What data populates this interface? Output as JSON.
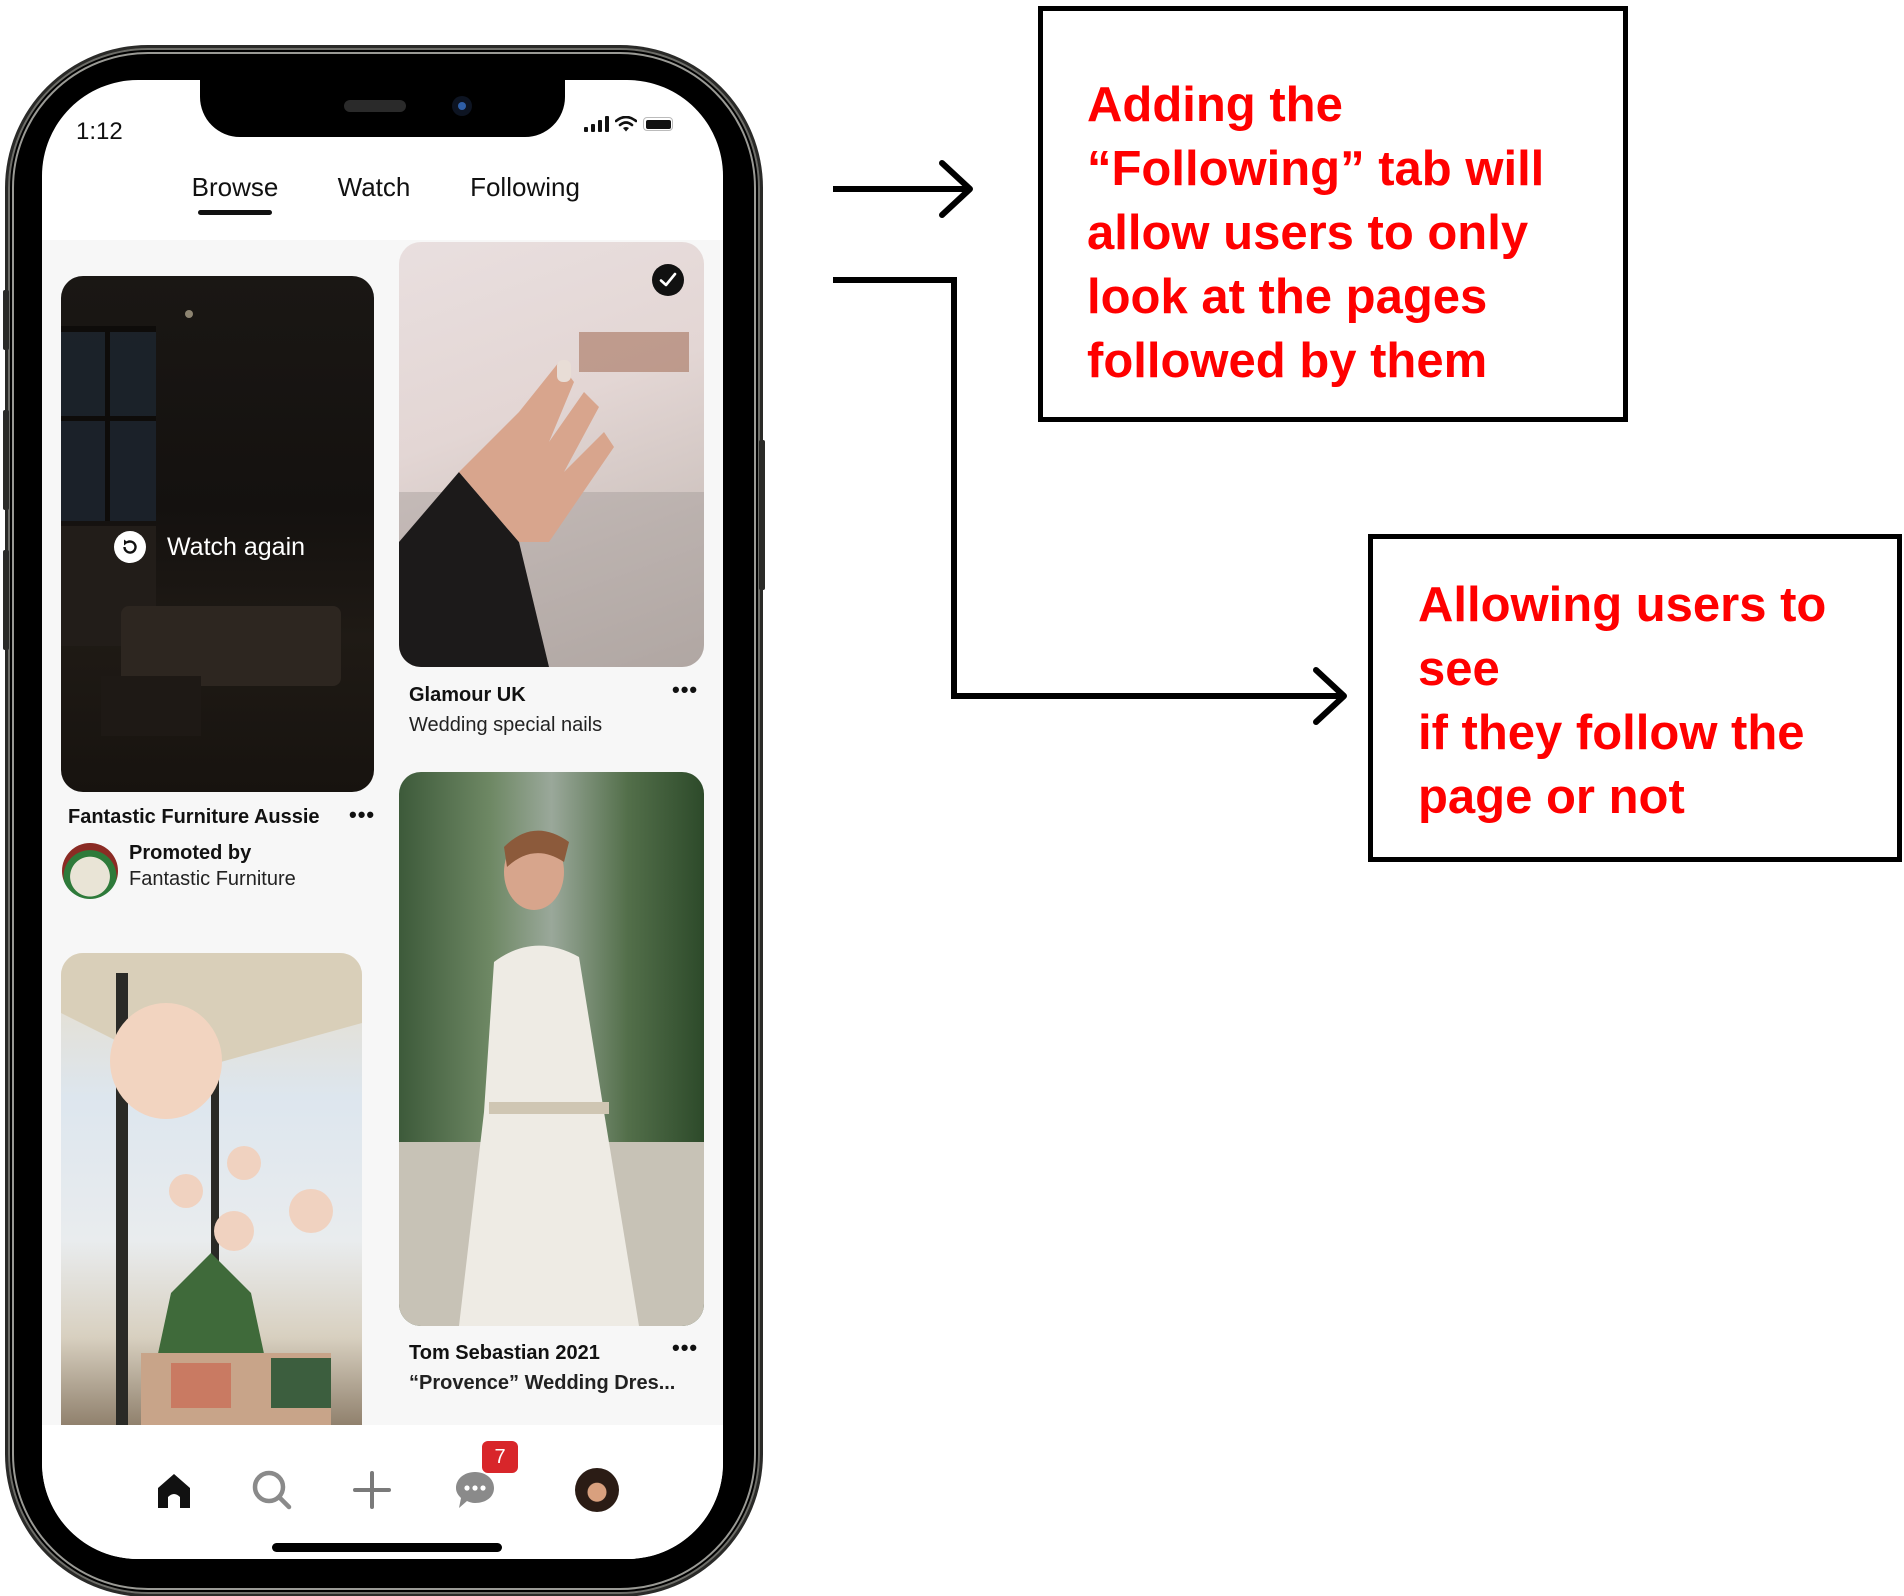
{
  "status_bar": {
    "time": "1:12"
  },
  "tabs": [
    {
      "label": "Browse",
      "active": true
    },
    {
      "label": "Watch",
      "active": false
    },
    {
      "label": "Following",
      "active": false
    }
  ],
  "pins": {
    "furniture": {
      "overlay_label": "Watch again",
      "title": "Fantastic Furniture Aussie",
      "promoted_label": "Promoted by",
      "promoter": "Fantastic Furniture",
      "more_label": "•••"
    },
    "nails": {
      "title": "Glamour UK",
      "subtitle": "Wedding special nails",
      "followed": true,
      "more_label": "•••"
    },
    "lanterns": {},
    "bride": {
      "title": "Tom Sebastian 2021",
      "subtitle": "“Provence” Wedding Dres...",
      "more_label": "•••"
    }
  },
  "navbar": {
    "items": [
      "home",
      "search",
      "create",
      "messages",
      "profile"
    ],
    "messages_badge": "7"
  },
  "annotations": [
    {
      "text": "Adding the\n“Following” tab will\nallow users to only\nlook at the pages\nfollowed by them"
    },
    {
      "text": "Allowing users to\nsee\nif they follow the\npage or not"
    }
  ],
  "colors": {
    "annotation_text": "#ff0000",
    "badge": "#d8262a",
    "feed_bg": "#f7f7f7"
  }
}
